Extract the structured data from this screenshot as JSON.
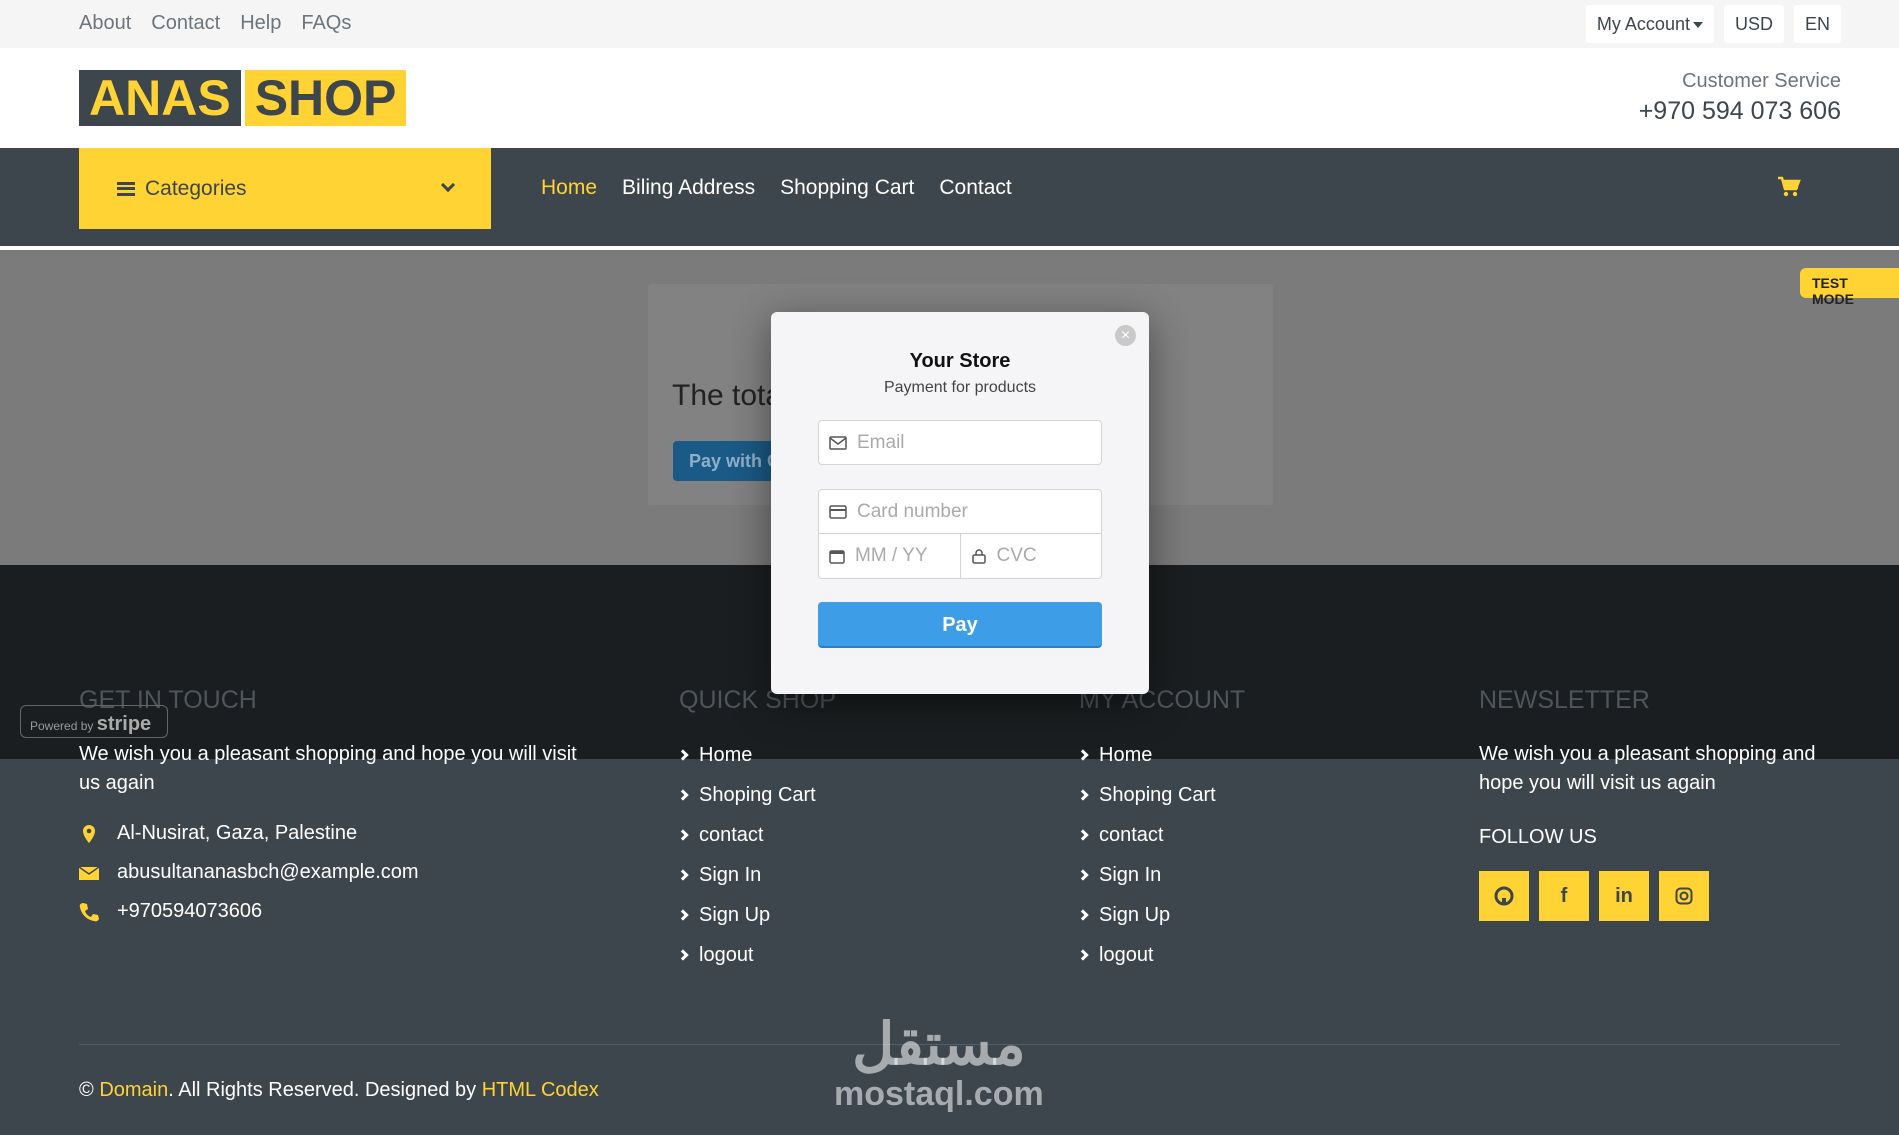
{
  "topbar": {
    "links": [
      "About",
      "Contact",
      "Help",
      "FAQs"
    ],
    "account": "My Account",
    "currency": "USD",
    "language": "EN"
  },
  "header": {
    "logo_part1": "ANAS",
    "logo_part2": "SHOP",
    "cs_title": "Customer Service",
    "cs_phone": "+970 594 073 606"
  },
  "nav": {
    "categories": "Categories",
    "items": [
      "Home",
      "Biling Address",
      "Shopping Cart",
      "Contact"
    ]
  },
  "content": {
    "total_text": "The tota",
    "pay_with": "Pay with C"
  },
  "modal": {
    "store": "Your Store",
    "subtitle": "Payment for products",
    "email_placeholder": "Email",
    "card_placeholder": "Card number",
    "expiry_placeholder": "MM / YY",
    "cvc_placeholder": "CVC",
    "pay": "Pay",
    "close": "×"
  },
  "badges": {
    "test_mode": "TEST MODE",
    "powered_by": "Powered by",
    "stripe": "stripe"
  },
  "footer": {
    "touch_title": "GET IN TOUCH",
    "touch_text": "We wish you a pleasant shopping and hope you will visit us again",
    "address": "Al-Nusirat, Gaza, Palestine",
    "email": "abusultananasbch@example.com",
    "phone": "+970594073606",
    "quick_title": "QUICK SHOP",
    "quick_items": [
      "Home",
      "Shoping Cart",
      "contact",
      "Sign In",
      "Sign Up",
      "logout"
    ],
    "account_title": "MY ACCOUNT",
    "account_items": [
      "Home",
      "Shoping Cart",
      "contact",
      "Sign In",
      "Sign Up",
      "logout"
    ],
    "newsletter_title": "NEWSLETTER",
    "newsletter_text": "We wish you a pleasant shopping and hope you will visit us again",
    "follow": "FOLLOW US",
    "copyright_prefix": "©",
    "copyright_domain": "Domain",
    "copyright_mid": ". All Rights Reserved. Designed by",
    "copyright_codex": "HTML Codex"
  },
  "watermark": {
    "arabic": "مستقل",
    "latin": "mostaql.com"
  },
  "colors": {
    "accent": "#ffd333",
    "dark": "#3d464d",
    "pay_button": "#3d9de6"
  }
}
